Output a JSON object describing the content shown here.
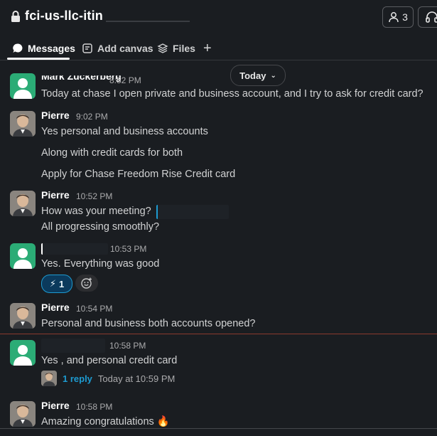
{
  "header": {
    "channel_name": "fci-us-llc-itin",
    "member_count": "3"
  },
  "tabs": [
    {
      "label": "Messages"
    },
    {
      "label": "Add canvas"
    },
    {
      "label": "Files"
    }
  ],
  "date_divider": "Today",
  "messages": [
    {
      "name": "Mark Zuckerberg",
      "time": "8:52 PM",
      "lines": [
        "Today at chase I open private and business account, and I try to ask for credit card?"
      ]
    },
    {
      "name": "Pierre",
      "time": "9:02 PM",
      "lines": [
        "Yes personal and business accounts",
        "Along with credit cards for both",
        "Apply for Chase Freedom Rise Credit card"
      ]
    },
    {
      "name": "Pierre",
      "time": "10:52 PM",
      "lines": [
        "How was your meeting?",
        "All progressing smoothly?"
      ]
    },
    {
      "name": "",
      "time": "10:53 PM",
      "lines": [
        "Yes. Everything was good"
      ],
      "reaction": {
        "emoji": "⚡",
        "count": "1"
      }
    },
    {
      "name": "Pierre",
      "time": "10:54 PM",
      "lines": [
        "Personal and business both accounts opened?"
      ]
    },
    {
      "name": "",
      "time": "10:58 PM",
      "lines": [
        "Yes , and personal credit card"
      ],
      "thread": {
        "replies": "1 reply",
        "last": "Today at 10:59 PM"
      }
    },
    {
      "name": "Pierre",
      "time": "10:58 PM",
      "lines": [
        "Amazing congratulations 🔥"
      ]
    }
  ],
  "colors": {
    "accent": "#1d9bd1",
    "green": "#2bac76",
    "new_divider": "#8a3a2e"
  }
}
